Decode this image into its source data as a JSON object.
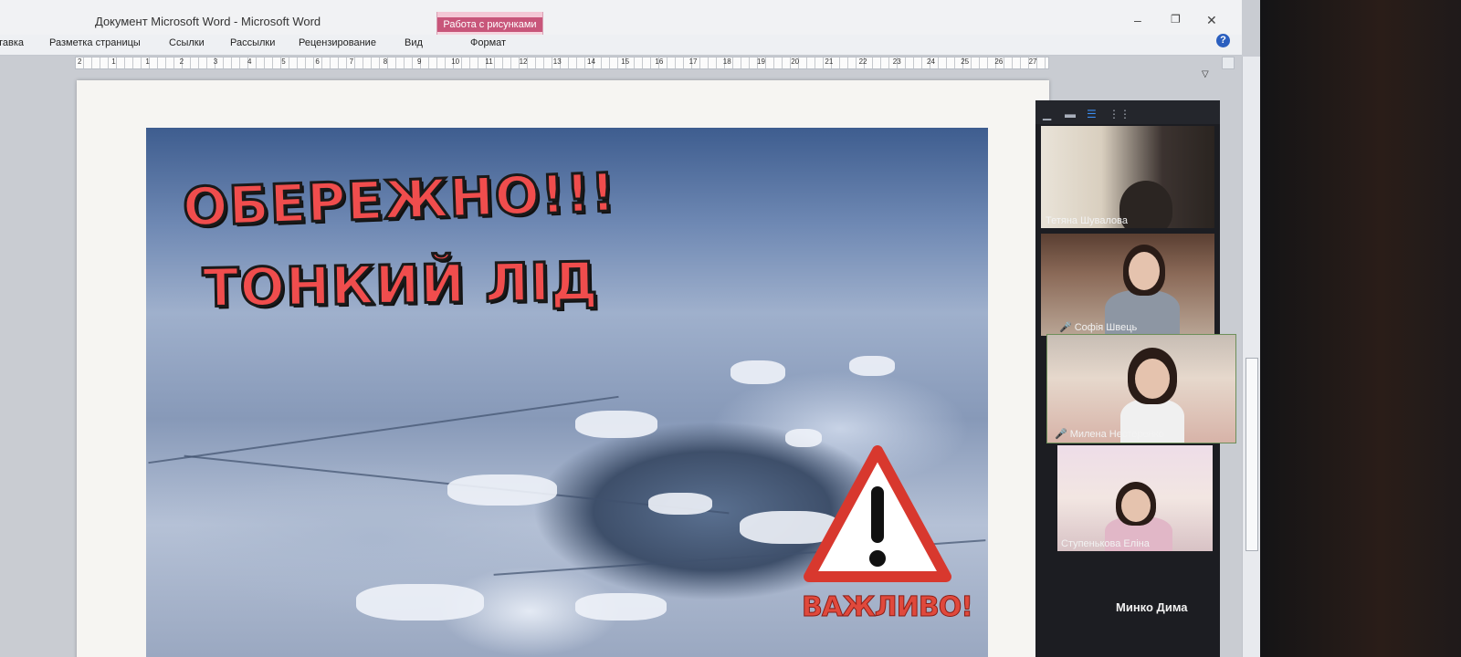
{
  "window": {
    "title": "Документ Microsoft Word  -  Microsoft Word",
    "picture_tools": "Работа с рисунками",
    "controls": {
      "minimize": "–",
      "restore": "❐",
      "close": "✕"
    }
  },
  "ribbon": {
    "tabs": [
      "тавка",
      "Разметка страницы",
      "Ссылки",
      "Рассылки",
      "Рецензирование",
      "Вид",
      "Формат"
    ],
    "help": "?"
  },
  "ruler": {
    "numbers": [
      "2",
      "1",
      "1",
      "2",
      "3",
      "4",
      "5",
      "6",
      "7",
      "8",
      "9",
      "10",
      "11",
      "12",
      "13",
      "14",
      "15",
      "16",
      "17",
      "18",
      "19",
      "20",
      "21",
      "22",
      "23",
      "24",
      "25",
      "26",
      "27"
    ]
  },
  "document": {
    "headline_line1": "ОБЕРЕЖНО!!!",
    "headline_line2": "ТОНКИЙ ЛІД",
    "warning_label": "ВАЖЛИВО!",
    "warning_icon": "warning-triangle-icon"
  },
  "zoom_gallery": {
    "toolbar_icons": [
      "minimize-icon",
      "window-icon",
      "speaker-view-icon",
      "gallery-view-icon"
    ],
    "participants": [
      {
        "name": "Тетяна Шувалова",
        "muted": false
      },
      {
        "name": "Софія Швець",
        "muted": true
      },
      {
        "name": "Милена Нестеренко",
        "muted": true
      },
      {
        "name": "Ступенькова Еліна",
        "muted": false
      },
      {
        "name": "Минко Дима",
        "muted": false
      }
    ]
  },
  "colors": {
    "headline": "#f04d4d",
    "picture_tools_tab": "#c8567a",
    "zoom_panel": "#1c1d22",
    "mic_muted": "#e04545"
  }
}
